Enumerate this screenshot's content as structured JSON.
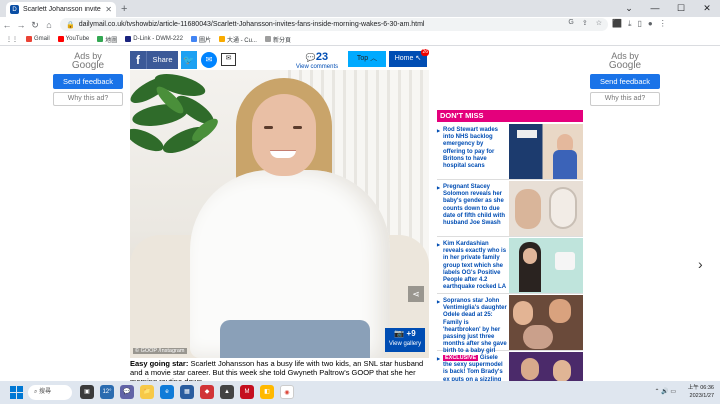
{
  "browser": {
    "tab_title": "Scarlett Johansson invites fans",
    "url": "dailymail.co.uk/tvshowbiz/article-11680043/Scarlett-Johansson-invites-fans-inside-morning-wakes-6-30-am.html",
    "bookmarks": [
      {
        "label": "Gmail",
        "color": "#ea4335"
      },
      {
        "label": "YouTube",
        "color": "#ff0000"
      },
      {
        "label": "地圖",
        "color": "#34a853"
      },
      {
        "label": "D-Link - DWM-222",
        "color": "#1a237e"
      },
      {
        "label": "圖片",
        "color": "#4285f4"
      },
      {
        "label": "大通 - Cu...",
        "color": "#f9ab00"
      },
      {
        "label": "新分頁",
        "color": "#9e9e9e"
      }
    ]
  },
  "ads": {
    "left": {
      "title_line1": "Ads by",
      "title_line2": "Google",
      "feedback": "Send feedback",
      "why": "Why this ad?"
    },
    "right": {
      "title_line1": "Ads by",
      "title_line2": "Google",
      "feedback": "Send feedback",
      "why": "Why this ad?"
    }
  },
  "sharebar": {
    "share_label": "Share",
    "comment_count": "23",
    "comments_label": "View comments",
    "top_label": "Top",
    "home_label": "Home",
    "home_badge": "26"
  },
  "photo": {
    "credit": "© GOOP /Instagram",
    "gallery_count": "+9",
    "gallery_label": "View gallery"
  },
  "caption": {
    "lead": "Easy going star:",
    "text": " Scarlett Johansson has a busy life with two kids, an SNL star husband and a movie star career. But this week she told Gwyneth Paltrow's GOOP that she her morning routine down"
  },
  "dont_miss": {
    "header": "DON'T MISS",
    "items": [
      {
        "text": "Rod Stewart wades into NHS backlog emergency by offering to pay for Britons to have hospital scans"
      },
      {
        "text": "Pregnant Stacey Solomon reveals her baby's gender as she counts down to due date of fifth child with husband Joe Swash"
      },
      {
        "text": "Kim Kardashian reveals exactly who is in her private family group text which she labels OG's Positive People after 4.2 earthquake rocked LA"
      },
      {
        "text": "Sopranos star John Ventimiglia's daughter Odele dead at 25: Family is 'heartbroken' by her passing just three months after she gave birth to a baby girl"
      },
      {
        "exclusive": "EXCLUSIVE",
        "text": " Gisele the sexy supermodel is back! Tom Brady's ex puts on a sizzling"
      }
    ]
  },
  "taskbar": {
    "search": "搜尋",
    "time": "上午 06:36",
    "date": "2023/1/27",
    "weather_badge": "12°"
  }
}
